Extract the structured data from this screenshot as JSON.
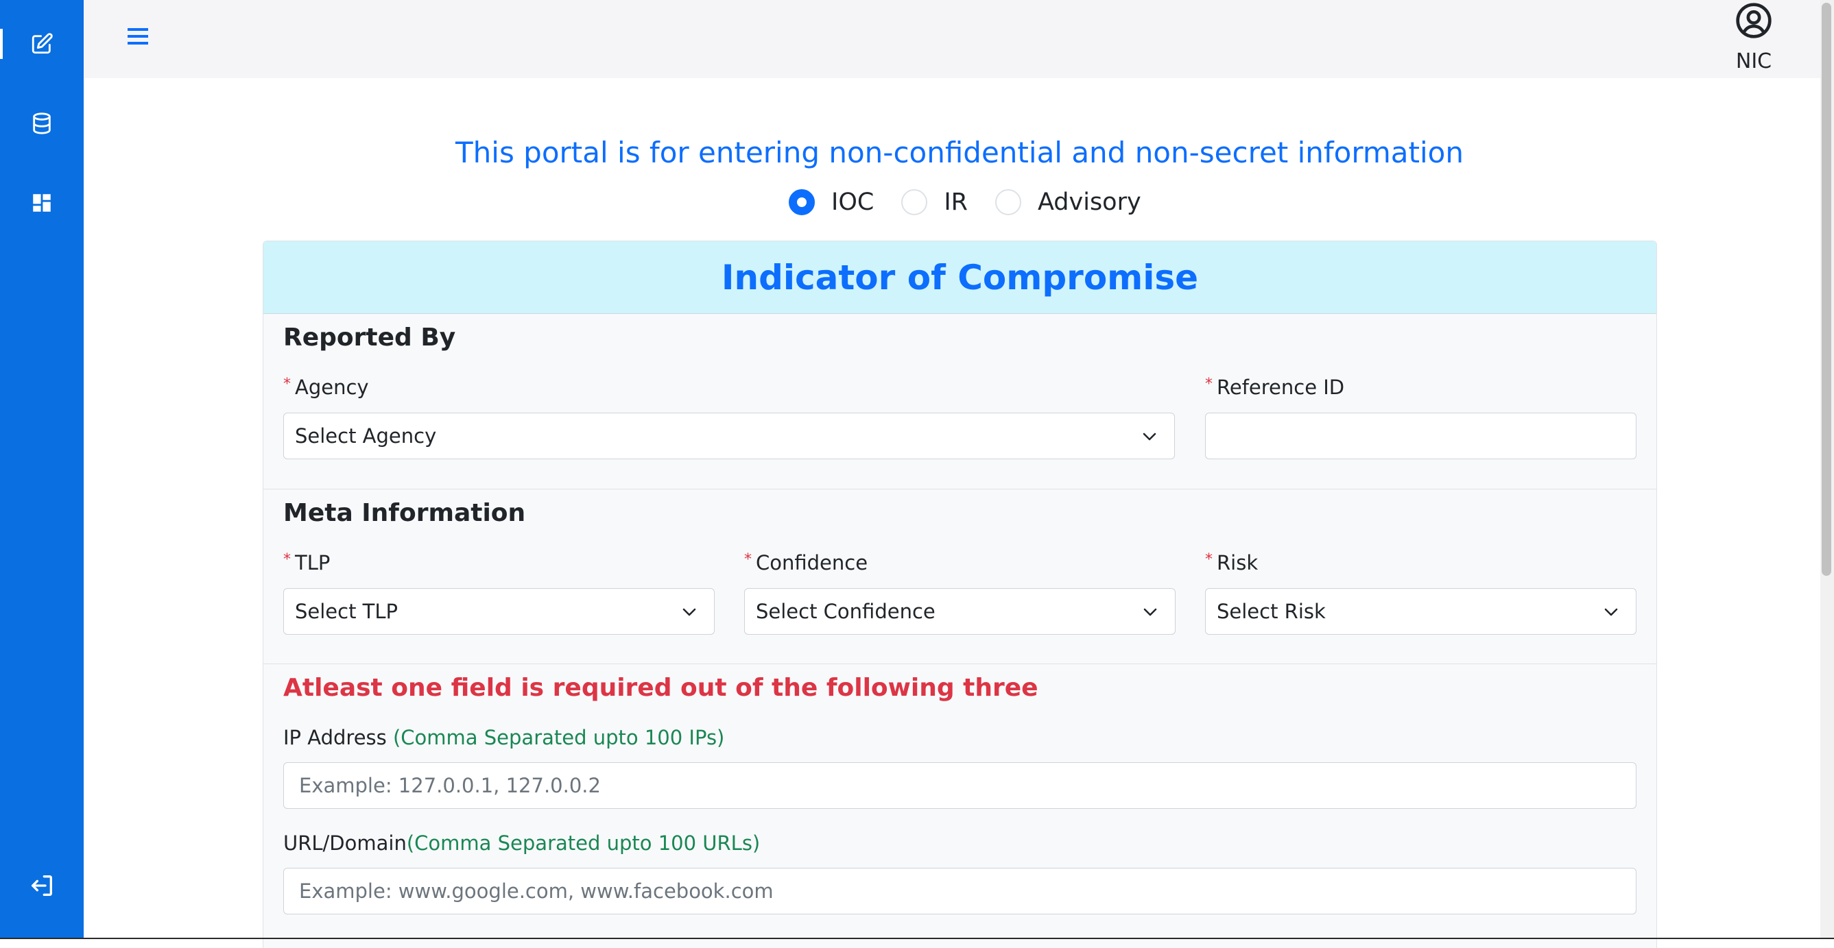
{
  "header": {
    "user_name": "NIC"
  },
  "notice": "This portal is for entering non-confidential and non-secret information",
  "entry_types": [
    {
      "label": "IOC",
      "checked": true
    },
    {
      "label": "IR",
      "checked": false
    },
    {
      "label": "Advisory",
      "checked": false
    }
  ],
  "card": {
    "title": "Indicator of Compromise"
  },
  "reported_by": {
    "title": "Reported By",
    "agency_label": "Agency",
    "agency_value": "Select Agency",
    "reference_label": "Reference ID",
    "reference_value": ""
  },
  "meta": {
    "title": "Meta Information",
    "tlp_label": "TLP",
    "tlp_value": "Select TLP",
    "confidence_label": "Confidence",
    "confidence_value": "Select Confidence",
    "risk_label": "Risk",
    "risk_value": "Select Risk"
  },
  "indicators": {
    "warning": "Atleast one field is required out of the following three",
    "ip_label": "IP Address",
    "ip_hint": "(Comma Separated upto 100 IPs)",
    "ip_placeholder": "Example: 127.0.0.1, 127.0.0.2",
    "url_label": "URL/Domain",
    "url_hint": "(Comma Separated upto 100 URLs)",
    "url_placeholder": "Example: www.google.com, www.facebook.com"
  },
  "sidebar": {
    "items": [
      {
        "icon": "edit-icon"
      },
      {
        "icon": "database-icon"
      },
      {
        "icon": "dashboard-icon"
      }
    ],
    "logout_icon": "logout-icon"
  },
  "colors": {
    "sidebar": "#0a6fe0",
    "primary": "#0d6efd",
    "danger": "#dc3545",
    "success": "#198754",
    "card_header": "#cff4fc"
  }
}
